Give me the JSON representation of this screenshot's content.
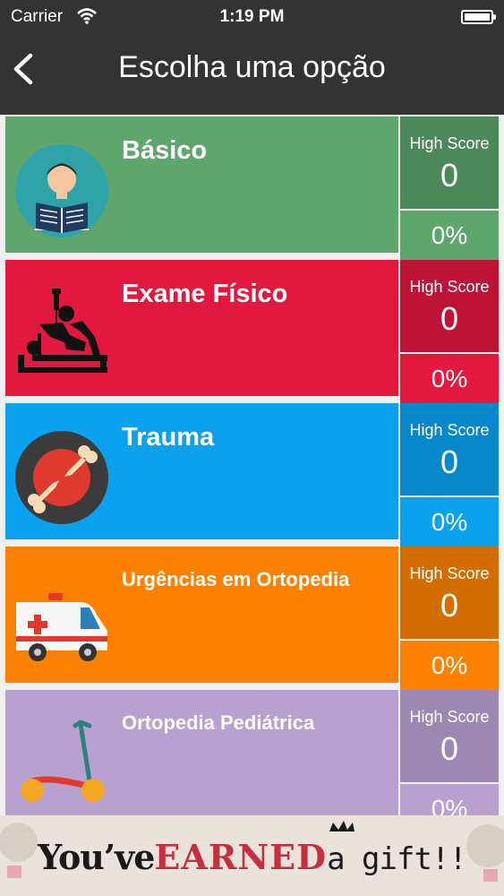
{
  "status_bar": {
    "carrier": "Carrier",
    "time": "1:19 PM"
  },
  "nav": {
    "title": "Escolha uma opção"
  },
  "categories": [
    {
      "title": "Básico",
      "high_score_label": "High Score",
      "high_score": "0",
      "percent": "0%",
      "icon": "student-reading-icon",
      "color_main": "#5fa66d",
      "color_score": "#4b8a58",
      "color_pct": "#5fa66d"
    },
    {
      "title": "Exame Físico",
      "high_score_label": "High Score",
      "high_score": "0",
      "percent": "0%",
      "icon": "physiotherapy-icon",
      "color_main": "#e2183f",
      "color_score": "#bf1335",
      "color_pct": "#e2183f"
    },
    {
      "title": "Trauma",
      "high_score_label": "High Score",
      "high_score": "0",
      "percent": "0%",
      "icon": "broken-bone-icon",
      "color_main": "#0aa2ef",
      "color_score": "#0688cb",
      "color_pct": "#0aa2ef"
    },
    {
      "title": "Urgências em Ortopedia",
      "high_score_label": "High Score",
      "high_score": "0",
      "percent": "0%",
      "icon": "ambulance-icon",
      "color_main": "#fd8100",
      "color_score": "#d46d00",
      "color_pct": "#fd8100"
    },
    {
      "title": "Ortopedia Pediátrica",
      "high_score_label": "High Score",
      "high_score": "0",
      "percent": "0%",
      "icon": "kick-scooter-icon",
      "color_main": "#b8a1d1",
      "color_score": "#9d88b4",
      "color_pct": "#b8a1d1"
    }
  ],
  "ad": {
    "part1": "You’ve",
    "part2": "EARNED",
    "part3": "a gift!!"
  }
}
